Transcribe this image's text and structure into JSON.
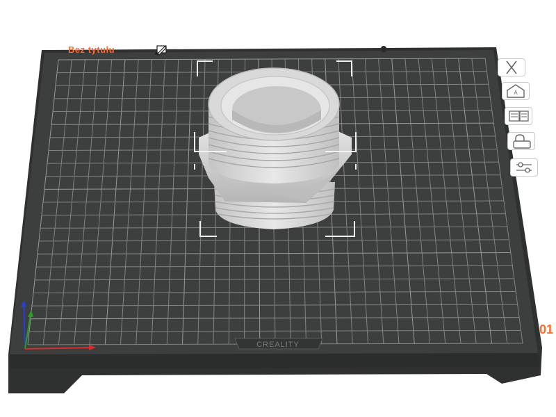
{
  "plate": {
    "title": "Bez tytułu",
    "brand": "CREALITY",
    "number": "01",
    "colors": {
      "plate": "#3a3b3b",
      "grid": "#8e9090",
      "accent": "#ff6a2b",
      "model": "#d6d6d6"
    }
  },
  "icons": {
    "edit_plate_name": "edit-icon",
    "lock": "lock-icon"
  },
  "toolbar": [
    {
      "name": "delete-plate-button",
      "icon": "close-icon"
    },
    {
      "name": "auto-arrange-button",
      "icon": "arrange-icon"
    },
    {
      "name": "orient-button",
      "icon": "orient-icon"
    },
    {
      "name": "lock-plate-button",
      "icon": "lock-icon"
    },
    {
      "name": "plate-settings-button",
      "icon": "settings-sliders-icon"
    }
  ],
  "axes": {
    "x_color": "#d32f2f",
    "y_color": "#2e9b2e",
    "z_color": "#2a3fd4"
  }
}
